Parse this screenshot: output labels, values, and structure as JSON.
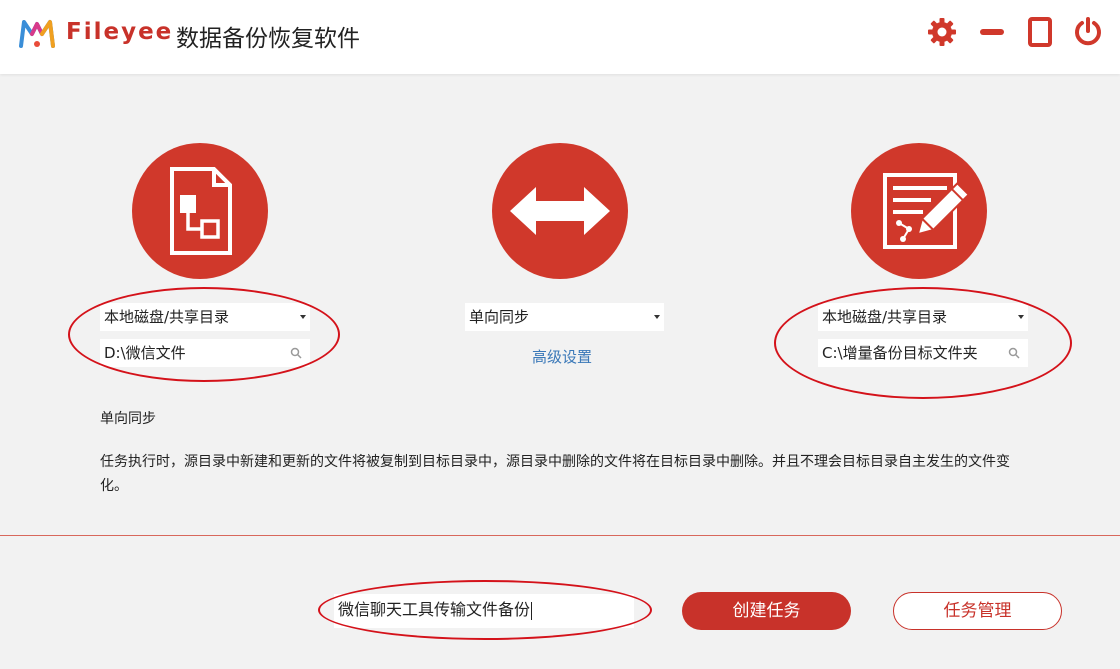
{
  "header": {
    "brand": "Fileyee",
    "title": "数据备份恢复软件",
    "controls": [
      "gear-icon",
      "minimize-icon",
      "maximize-icon",
      "power-icon"
    ]
  },
  "source": {
    "icon": "document-flowchart-icon",
    "type_selected": "本地磁盘/共享目录",
    "path": "D:\\微信文件"
  },
  "sync": {
    "icon": "double-arrow-icon",
    "mode_selected": "单向同步",
    "advanced_label": "高级设置"
  },
  "target": {
    "icon": "edit-document-icon",
    "type_selected": "本地磁盘/共享目录",
    "path": "C:\\增量备份目标文件夹"
  },
  "description": {
    "title": "单向同步",
    "text": "任务执行时，源目录中新建和更新的文件将被复制到目标目录中，源目录中删除的文件将在目标目录中删除。并且不理会目标目录自主发生的文件变化。"
  },
  "footer": {
    "task_name": "微信聊天工具传输文件备份",
    "create_label": "创建任务",
    "manage_label": "任务管理"
  },
  "colors": {
    "accent": "#c8322a",
    "circle": "#d0382b",
    "link": "#3a78b8",
    "annotation": "#d4121a"
  }
}
